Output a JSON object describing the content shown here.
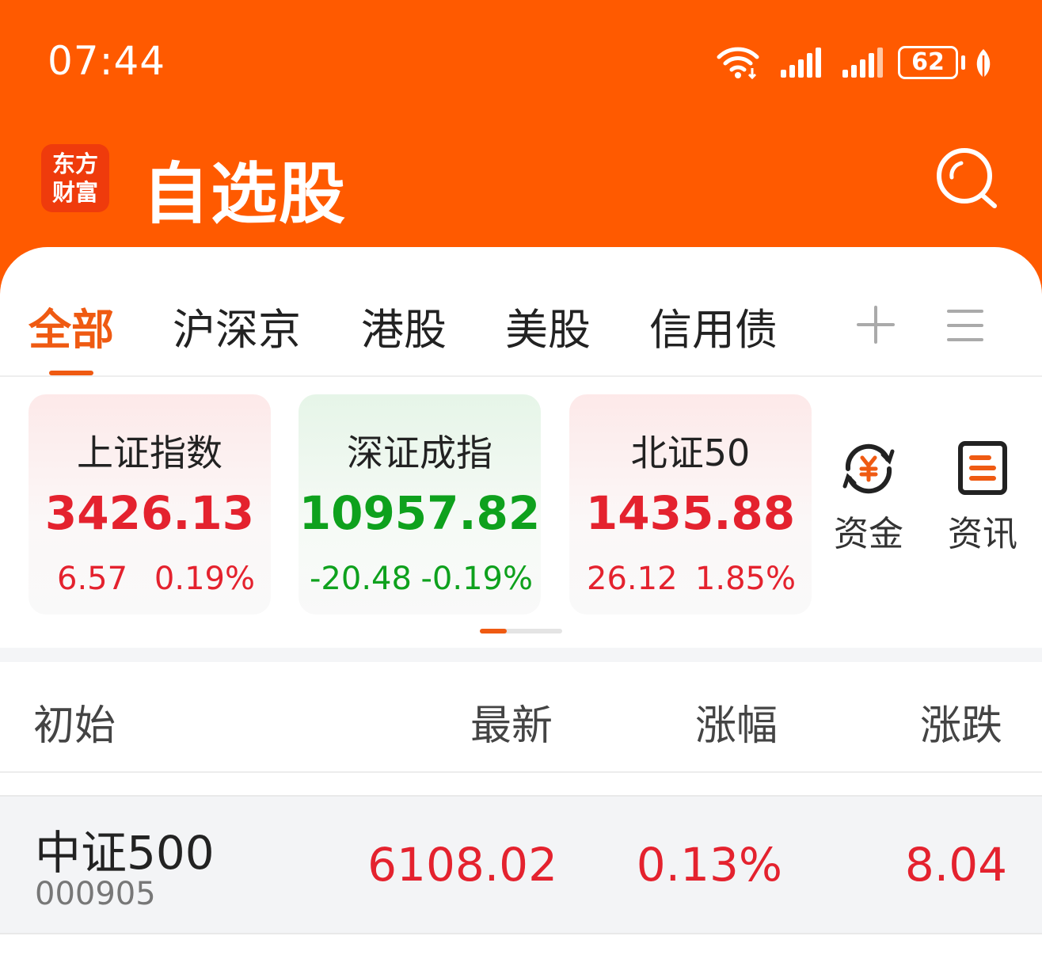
{
  "status": {
    "time": "07:44",
    "battery": "62"
  },
  "header": {
    "logo_line1": "东方",
    "logo_line2": "财富",
    "title": "自选股"
  },
  "tabs": [
    {
      "label": "全部",
      "active": true
    },
    {
      "label": "沪深京"
    },
    {
      "label": "港股"
    },
    {
      "label": "美股"
    },
    {
      "label": "信用债"
    }
  ],
  "indices": [
    {
      "name": "上证指数",
      "value": "3426.13",
      "change": "6.57",
      "pct": "0.19%"
    },
    {
      "name": "深证成指",
      "value": "10957.82",
      "change": "-20.48",
      "pct": "-0.19%"
    },
    {
      "name": "北证50",
      "value": "1435.88",
      "change": "26.12",
      "pct": "1.85%"
    }
  ],
  "quick": {
    "funds": "资金",
    "news": "资讯"
  },
  "columns": {
    "name": "初始",
    "latest": "最新",
    "pct": "涨幅",
    "change": "涨跌"
  },
  "rows": [
    {
      "name": "中证500",
      "code": "000905",
      "latest": "6108.02",
      "pct": "0.13%",
      "change": "8.04"
    }
  ],
  "colors": {
    "brand": "#ff5a00",
    "up": "#e4222e",
    "down": "#0ea11d",
    "accent": "#ef5a12"
  }
}
